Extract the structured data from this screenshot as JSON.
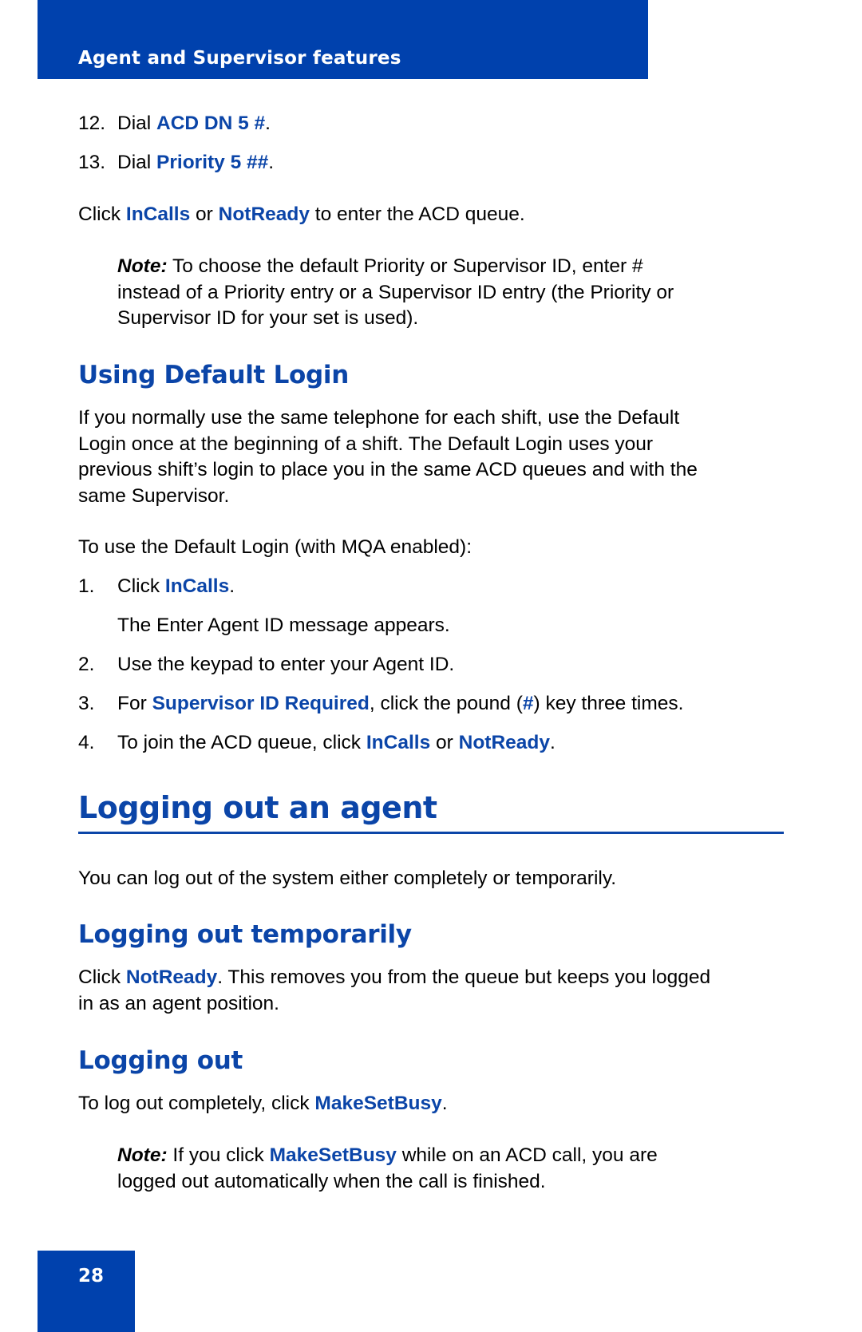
{
  "header": {
    "section_title": "Agent and Supervisor features"
  },
  "steps_top": [
    {
      "num": "12.",
      "pre": "Dial ",
      "kw": "ACD DN 5 #",
      "post": "."
    },
    {
      "num": "13.",
      "pre": "Dial ",
      "kw": "Priority 5 ##",
      "post": "."
    }
  ],
  "enter_queue": {
    "pre": "Click ",
    "kw1": "InCalls",
    "mid": " or ",
    "kw2": "NotReady",
    "post": " to enter the ACD queue."
  },
  "note1": {
    "label": "Note:",
    "lines": [
      " To choose the default Priority or Supervisor ID, enter #",
      "instead of a Priority entry or a Supervisor ID entry (the Priority or",
      "Supervisor ID for your set is used)."
    ]
  },
  "default_login": {
    "heading": "Using Default Login",
    "para_lines": [
      "If you normally use the same telephone for each shift, use the Default",
      "Login once at the beginning of a shift. The Default Login uses your",
      "previous shift’s login to place you in the same ACD queues and with the",
      "same Supervisor."
    ],
    "intro": "To use the Default Login (with MQA enabled):",
    "step1": {
      "num": "1.",
      "pre": "Click ",
      "kw": "InCalls",
      "post": "."
    },
    "step1_sub": "The Enter Agent ID message appears.",
    "step2": {
      "num": "2.",
      "text": "Use the keypad to enter your Agent ID."
    },
    "step3": {
      "num": "3.",
      "pre": "For ",
      "kw": "Supervisor ID Required",
      "mid": ", click the pound (",
      "kw2": "#",
      "post": ") key three times."
    },
    "step4": {
      "num": "4.",
      "pre": "To join the ACD queue, click ",
      "kw1": "InCalls",
      "mid": " or ",
      "kw2": "NotReady",
      "post": "."
    }
  },
  "logging_out_agent": {
    "heading": "Logging out an agent",
    "intro": "You can log out of the system either completely or temporarily."
  },
  "logging_out_temp": {
    "heading": "Logging out temporarily",
    "pre": "Click ",
    "kw": "NotReady",
    "post": ". This removes you from the queue but keeps you logged",
    "line2": "in as an agent position."
  },
  "logging_out": {
    "heading": "Logging out",
    "pre": "To log out completely, click ",
    "kw": "MakeSetBusy",
    "post": ".",
    "note": {
      "label": "Note:",
      "pre": " If you click ",
      "kw": "MakeSetBusy",
      "post": " while on an ACD call, you are",
      "line2": "logged out automatically when the call is finished."
    }
  },
  "footer": {
    "page_number": "28"
  }
}
